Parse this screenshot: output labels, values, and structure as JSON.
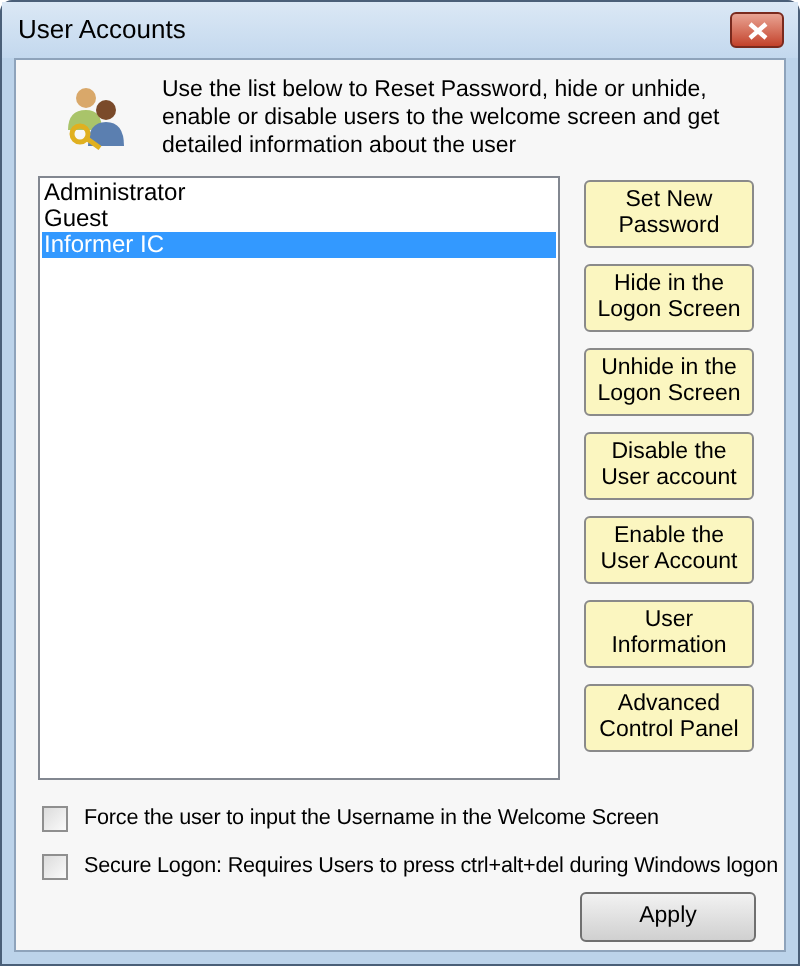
{
  "window": {
    "title": "User Accounts"
  },
  "description": "Use the list below to Reset Password, hide or unhide, enable or disable users to the welcome screen and get detailed information about the user",
  "users": [
    {
      "label": "Administrator",
      "selected": false
    },
    {
      "label": "Guest",
      "selected": false
    },
    {
      "label": "Informer IC",
      "selected": true
    }
  ],
  "actions": [
    "Set New Password",
    "Hide in the Logon Screen",
    "Unhide in the Logon Screen",
    "Disable the User account",
    "Enable the User Account",
    "User Information",
    "Advanced Control Panel"
  ],
  "options": [
    {
      "label": "Force the user to input the Username in the Welcome Screen",
      "checked": false
    },
    {
      "label": "Secure Logon: Requires Users to press ctrl+alt+del during Windows logon",
      "checked": false
    }
  ],
  "apply_button": "Apply"
}
